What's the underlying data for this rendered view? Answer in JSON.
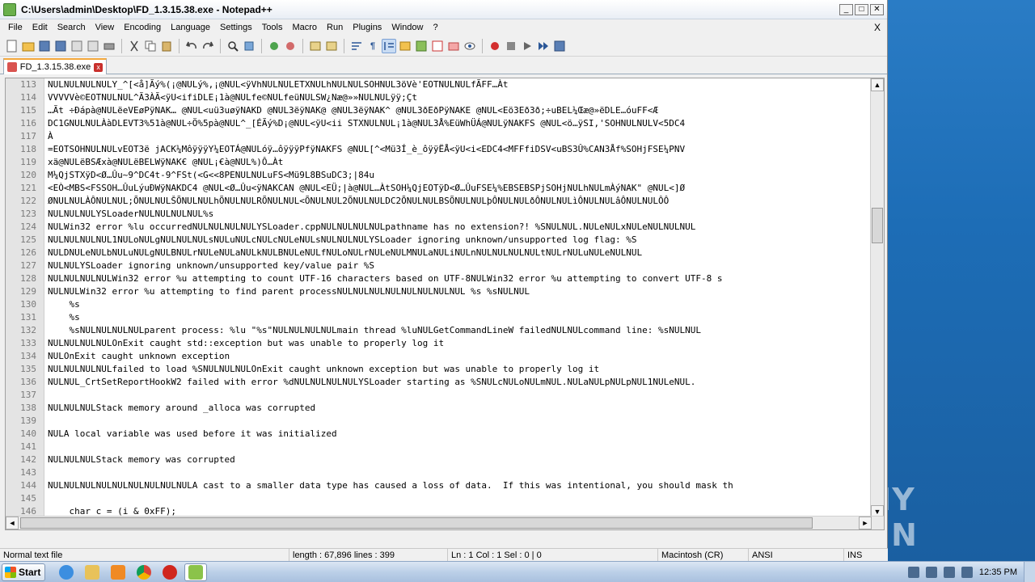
{
  "window": {
    "title": "C:\\Users\\admin\\Desktop\\FD_1.3.15.38.exe - Notepad++",
    "min": "_",
    "max": "□",
    "close": "✕"
  },
  "menu": {
    "items": [
      "File",
      "Edit",
      "Search",
      "View",
      "Encoding",
      "Language",
      "Settings",
      "Tools",
      "Macro",
      "Run",
      "Plugins",
      "Window",
      "?"
    ],
    "close": "X"
  },
  "tab": {
    "label": "FD_1.3.15.38.exe",
    "close": "x"
  },
  "editor": {
    "lines": [
      {
        "n": "113",
        "t": "NULNULNULNULY_^[<å]Ãý%(¡@NULý%,¡@NUL<ÿVhNULNULETXNULhNULNULSOHNUL3öVè'EOTNULNULfÃFF…Àt"
      },
      {
        "n": "114",
        "t": "VVVVVè©EOTNULNUL^Ã3ÀÃ<ÿU<ifiDLE¡1à@NULfe©NULfeüNULSW¿Næ@»»NULNULÿÿ;Çt"
      },
      {
        "n": "115",
        "t": "…Ãt ÷Ðápà@NULëeVEøPÿNAK… @NUL<uü3uøÿNAKD @NUL3ëÿNAK@ @NUL3ëÿNAK^ @NUL3ðEðPÿNAKE @NUL<Eö3Eð3ð;÷uBEL¼Œæ@»ëDLE…óuFF<Æ"
      },
      {
        "n": "116",
        "t": "DC1GNULNULÀàDLEVT3%51à@NUL÷Ö%5pà@NUL^_[ÉÃý%D¡@NUL<ÿU<ii STXNULNUL¡1à@NUL3Å%EüWhÜÁ@NULÿNAKFS @NUL<ö…ÿSI,'SOHNULNULV<5DC4"
      },
      {
        "n": "117",
        "t": "À"
      },
      {
        "n": "118",
        "t": "=EOTSOHNULNULvEOT3ë jACK¼MôÿÿÿY¼EOTÁ@NULóÿ…ôÿÿÿPfÿNAKFS @NUL[^<Mü3Í_è_ôÿÿËÅ<ÿU<i<EDC4<MFFfiDSV<uBS3Û%CAN3Åf%SOHjFSE¼PNV"
      },
      {
        "n": "119",
        "t": "xä@NULëBSÆxà@NULëBELWÿNAK€ @NUL¡€à@NUL%)Ô…Àt"
      },
      {
        "n": "120",
        "t": "M¼QjSTXÿD<Ø…Ûu~9^DC4t-9^FSt(<G<<8PENULNULuFS<Mü9L8BSuDC3;|84u"
      },
      {
        "n": "121",
        "t": "<EÒ<MBS<FSSOH…ÛuLýuÐWÿNAKDC4 @NUL<Ø…Ûu<ÿNAKCAN @NUL<EÜ;|à@NUL…ÀtSOH¼QjEOTÿD<Ø…ÛuFSE¼%EBSEBSPjSOHjNULhNULmÀýNAK\" @NUL<]Ø"
      },
      {
        "n": "122",
        "t": "ØNULNULÀÔNULNUL;ÕNULNULŠÕNULNULhÕNULNULRÕNULNUL<ÕNULNUL2ÕNULNULDC2ÕNULNULBSÕNULNULþÔNULNULðÔNULNULìÔNULNULâÔNULNULÔÔ"
      },
      {
        "n": "123",
        "t": "NULNULNULYSLoaderNULNULNULNUL%s"
      },
      {
        "n": "124",
        "t": "NULWin32 error %lu occurredNULNULNULNULYSLoader.cppNULNULNULNULpathname has no extension?! %SNULNUL.NULeNULxNULeNULNULNUL"
      },
      {
        "n": "125",
        "t": "NULNULNULNUL1NULoNULgNULNULNULsNULuNULcNULcNULeNULsNULNULNULYSLoader ignoring unknown/unsupported log flag: %S"
      },
      {
        "n": "126",
        "t": "NULDNULeNULbNULuNULgNULBNULrNULeNULaNULkNULBNULeNULfNULoNULrNULeNULMNULaNULiNULnNULNULNULNULtNULrNULuNULeNULNUL"
      },
      {
        "n": "127",
        "t": "NULNULYSLoader ignoring unknown/unsupported key/value pair %S"
      },
      {
        "n": "128",
        "t": "NULNULNULNULWin32 error %u attempting to count UTF-16 characters based on UTF-8NULWin32 error %u attempting to convert UTF-8 s"
      },
      {
        "n": "129",
        "t": "NULNULWin32 error %u attempting to find parent processNULNULNULNULNULNULNULNUL %s %sNULNUL"
      },
      {
        "n": "130",
        "t": "    %s"
      },
      {
        "n": "131",
        "t": "    %s"
      },
      {
        "n": "132",
        "t": "    %sNULNULNULNULparent process: %lu \"%s\"NULNULNULNULmain thread %luNULGetCommandLineW failedNULNULcommand line: %sNULNUL"
      },
      {
        "n": "133",
        "t": "NULNULNULNULOnExit caught std::exception but was unable to properly log it"
      },
      {
        "n": "134",
        "t": "NULOnExit caught unknown exception"
      },
      {
        "n": "135",
        "t": "NULNULNULNULfailed to load %SNULNULNULOnExit caught unknown exception but was unable to properly log it"
      },
      {
        "n": "136",
        "t": "NULNUL_CrtSetReportHookW2 failed with error %dNULNULNULNULYSLoader starting as %SNULcNULoNULmNUL.NULaNULpNULpNUL1NULeNUL."
      },
      {
        "n": "137",
        "t": ""
      },
      {
        "n": "138",
        "t": "NULNULNULStack memory around _alloca was corrupted"
      },
      {
        "n": "139",
        "t": ""
      },
      {
        "n": "140",
        "t": "NULA local variable was used before it was initialized"
      },
      {
        "n": "141",
        "t": ""
      },
      {
        "n": "142",
        "t": "NULNULNULStack memory was corrupted"
      },
      {
        "n": "143",
        "t": ""
      },
      {
        "n": "144",
        "t": "NULNULNULNULNULNULNULNULNULA cast to a smaller data type has caused a loss of data.  If this was intentional, you should mask th"
      },
      {
        "n": "145",
        "t": ""
      },
      {
        "n": "146",
        "t": "    char c = (i & 0xFF);"
      },
      {
        "n": "147",
        "t": ""
      }
    ]
  },
  "status": {
    "type": "Normal text file",
    "length": "length : 67,896    lines : 399",
    "pos": "Ln : 1    Col : 1    Sel : 0 | 0",
    "eol": "Macintosh (CR)",
    "enc": "ANSI",
    "ins": "INS"
  },
  "taskbar": {
    "start": "Start",
    "clock": "12:35 PM"
  },
  "watermark": "ANY RUN"
}
